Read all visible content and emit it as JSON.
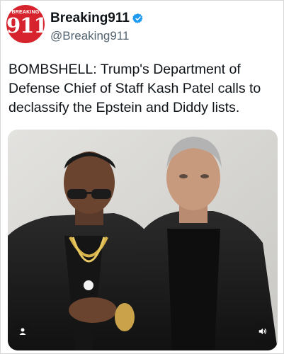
{
  "tweet": {
    "avatar": {
      "top_text": "BREAKING",
      "number_text": "911",
      "color": "#d7232e"
    },
    "display_name": "Breaking911",
    "verified_icon": "verified-badge-icon",
    "verified_color": "#1d9bf0",
    "handle": "@Breaking911",
    "text": "BOMBSHELL: Trump's Department of Defense Chief of Staff Kash Patel calls to declassify the Epstein and Diddy lists."
  },
  "media": {
    "icons": {
      "left": "user-icon",
      "right": "speaker-icon"
    }
  }
}
